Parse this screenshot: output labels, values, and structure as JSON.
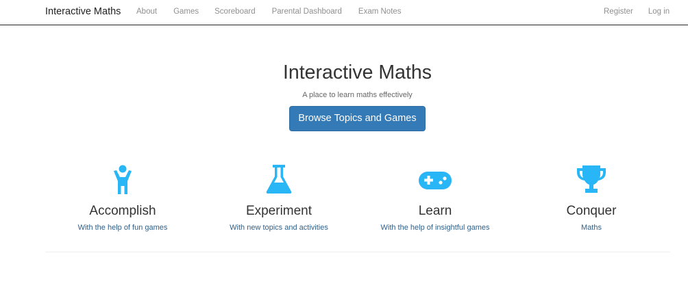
{
  "navbar": {
    "brand": "Interactive Maths",
    "left_links": [
      "About",
      "Games",
      "Scoreboard",
      "Parental Dashboard",
      "Exam Notes"
    ],
    "right_links": [
      "Register",
      "Log in"
    ]
  },
  "hero": {
    "title": "Interactive Maths",
    "subtitle": "A place to learn maths effectively",
    "button_label": "Browse Topics and Games"
  },
  "features": [
    {
      "icon": "person-icon",
      "title": "Accomplish",
      "description": "With the help of fun games"
    },
    {
      "icon": "flask-icon",
      "title": "Experiment",
      "description": "With new topics and activities"
    },
    {
      "icon": "gamepad-icon",
      "title": "Learn",
      "description": "With the help of insightful games"
    },
    {
      "icon": "trophy-icon",
      "title": "Conquer",
      "description": "Maths"
    }
  ],
  "colors": {
    "accent_icon": "#29b6f6",
    "primary_button": "#337ab7",
    "link_text": "#2f5f8a",
    "nav_text": "#8f8f8f"
  }
}
